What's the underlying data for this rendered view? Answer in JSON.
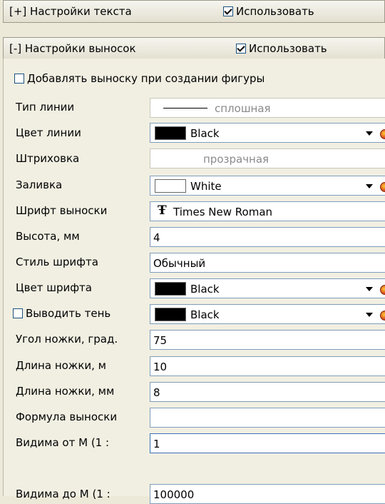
{
  "text_settings": {
    "title": "[+] Настройки текста",
    "use_label": "Использовать",
    "use_checked": true
  },
  "callout_settings": {
    "title": "[-] Настройки выносок",
    "use_label": "Использовать",
    "use_checked": true
  },
  "add_callout": {
    "label": "Добавлять выноску при создании фигуры",
    "checked": false
  },
  "rows": {
    "line_type": {
      "label": "Тип линии",
      "value": "сплошная"
    },
    "line_color": {
      "label": "Цвет линии",
      "color_name": "Black",
      "color": "#000000"
    },
    "hatching": {
      "label": "Штриховка",
      "value": "прозрачная"
    },
    "fill": {
      "label": "Заливка",
      "color_name": "White",
      "color": "#ffffff"
    },
    "font": {
      "label": "Шрифт выноски",
      "icon": "truetype-font-icon",
      "value": "Times New Roman"
    },
    "height": {
      "label": "Высота, мм",
      "value": "4"
    },
    "font_style": {
      "label": "Стиль шрифта",
      "value": "Обычный"
    },
    "font_color": {
      "label": "Цвет шрифта",
      "color_name": "Black",
      "color": "#000000"
    },
    "shadow": {
      "label": "Выводить тень",
      "checked": false,
      "color_name": "Black",
      "color": "#000000"
    },
    "leg_angle": {
      "label": "Угол ножки, град.",
      "value": "75"
    },
    "leg_length_m": {
      "label": "Длина ножки, м",
      "value": "10"
    },
    "leg_length_mm": {
      "label": "Длина ножки, мм",
      "value": "8"
    },
    "formula": {
      "label": "Формула выноски",
      "value": ""
    },
    "visible_from": {
      "label": "Видима от М (1 :",
      "value": "1"
    },
    "visible_to": {
      "label": "Видима до М (1 :",
      "value": "100000"
    }
  }
}
